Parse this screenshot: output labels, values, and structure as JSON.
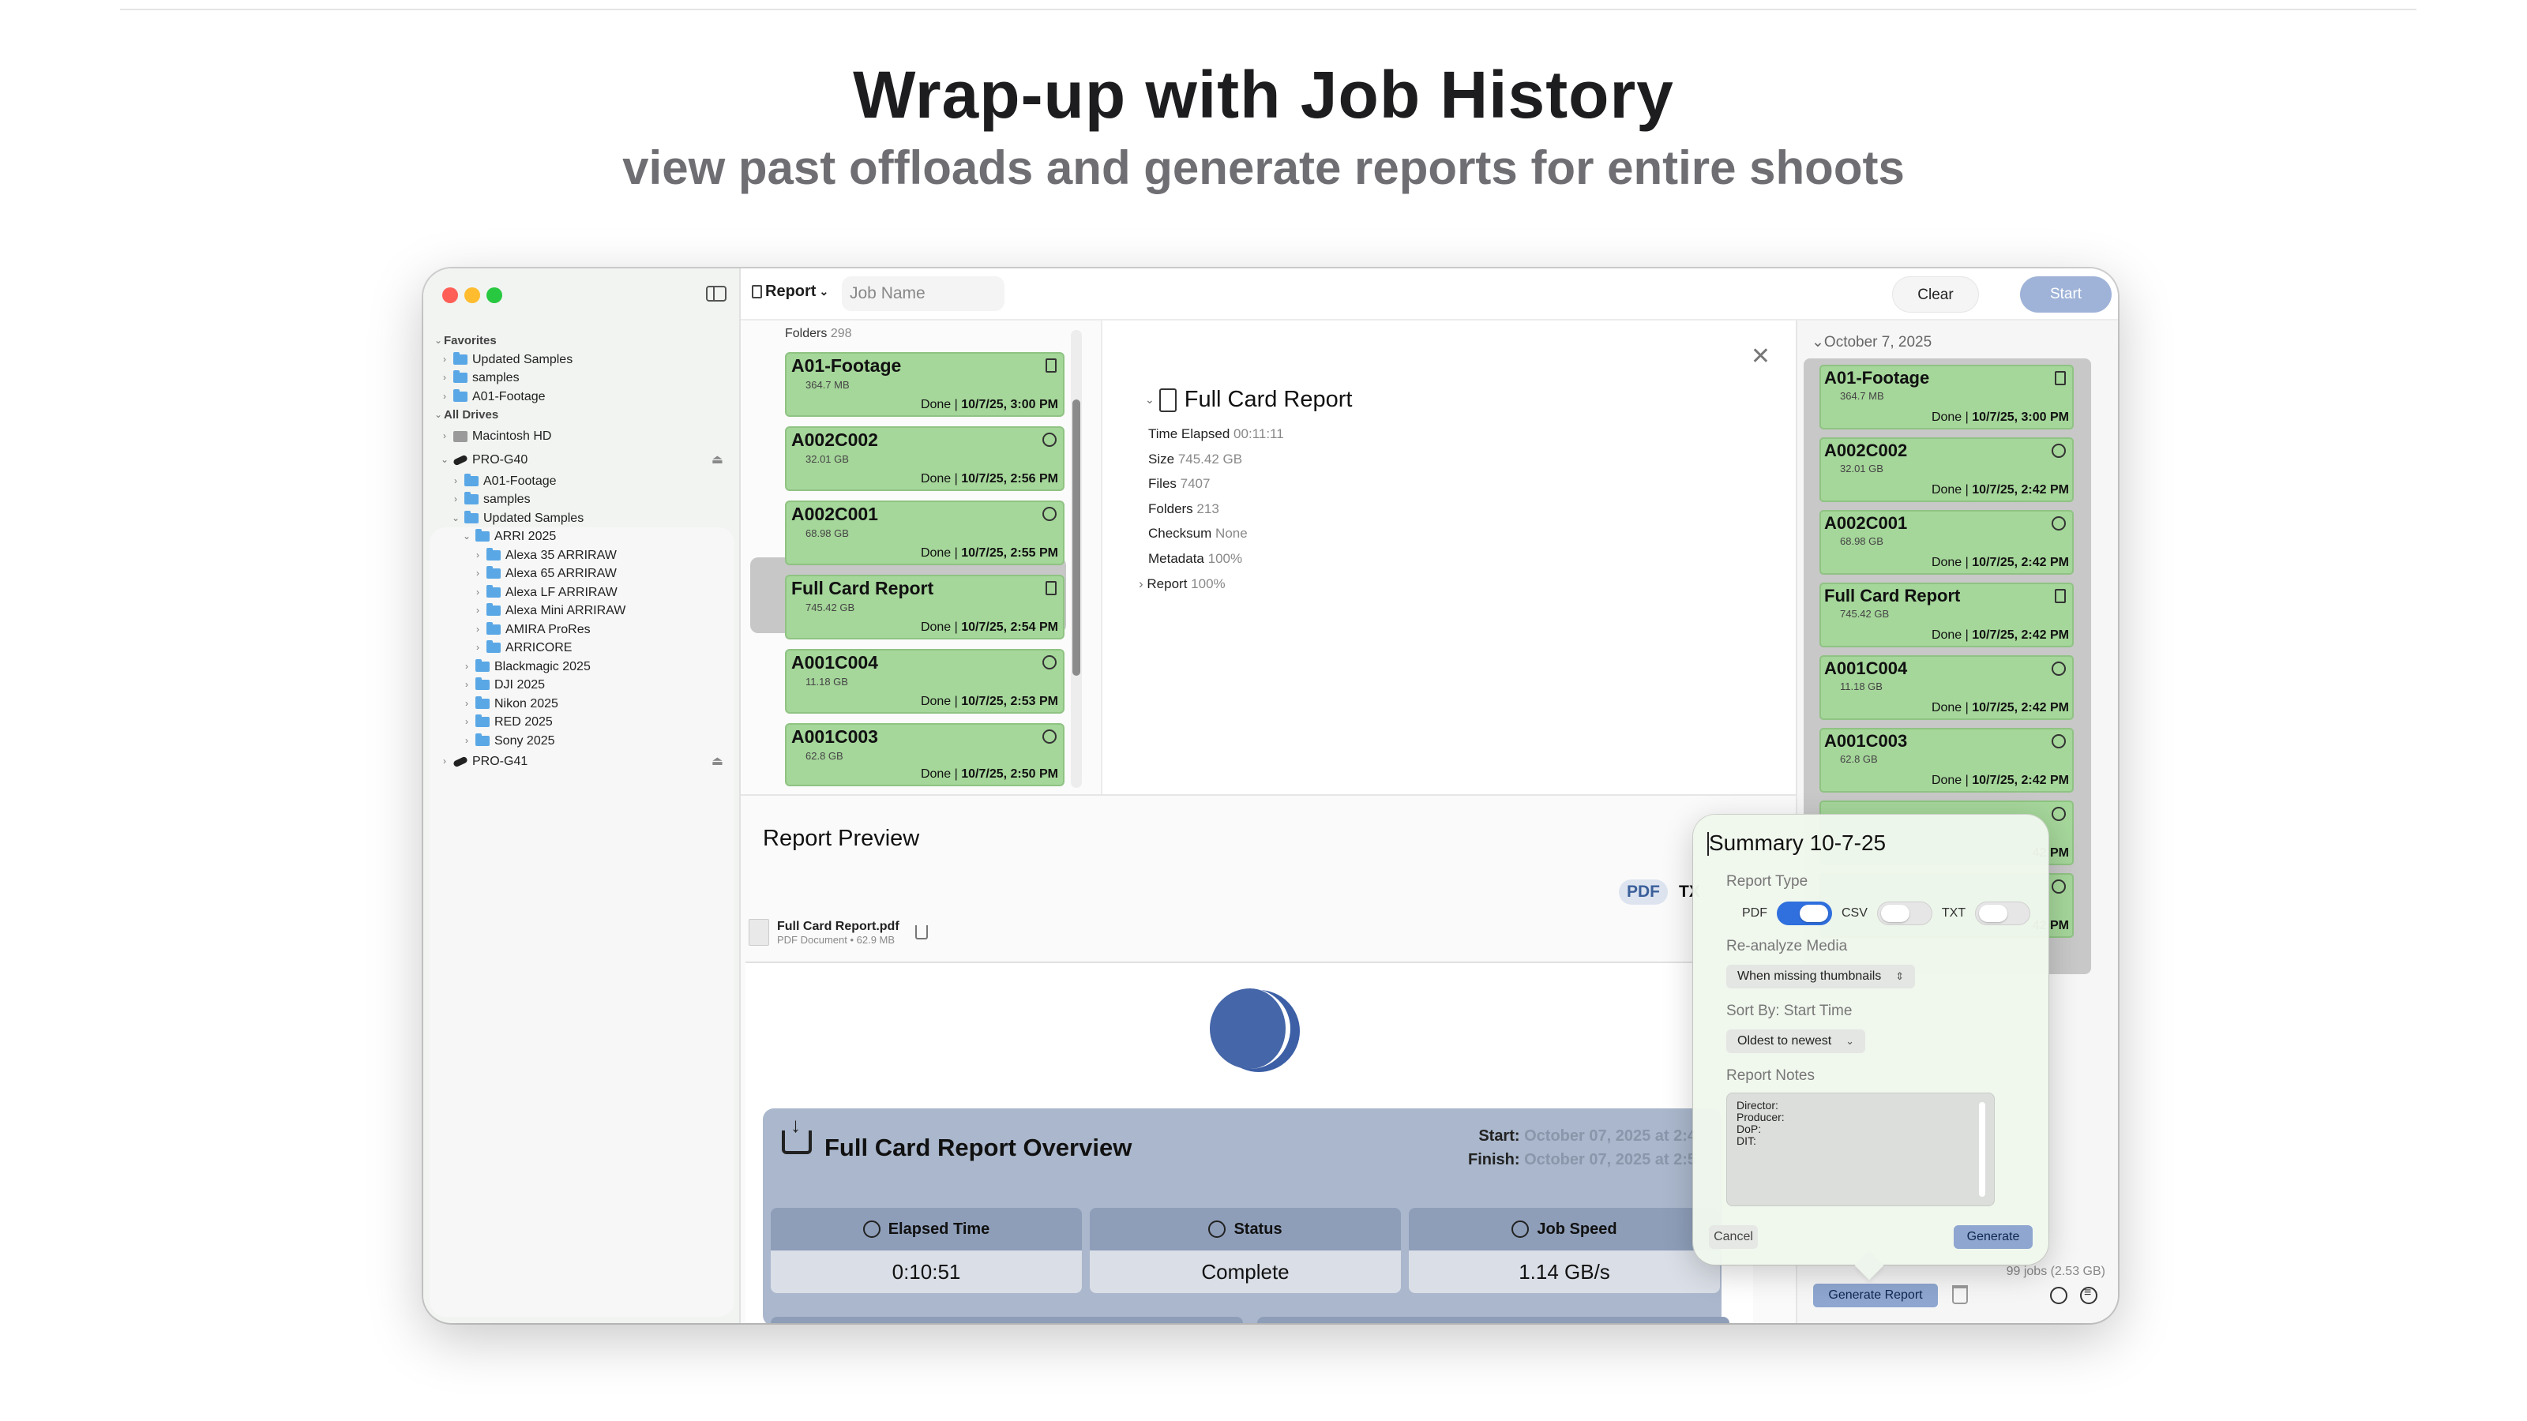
{
  "hero": {
    "title": "Wrap-up with Job History",
    "subtitle": "view past offloads and generate reports for entire shoots"
  },
  "toolbar": {
    "report_menu": "Report",
    "job_name_placeholder": "Job Name",
    "clear_label": "Clear",
    "start_label": "Start"
  },
  "sidebar": {
    "favorites_header": "Favorites",
    "favorites": [
      "Updated Samples",
      "samples",
      "A01-Footage"
    ],
    "all_drives_header": "All Drives",
    "drives": {
      "macintosh": "Macintosh HD",
      "pro_g40": "PRO-G40",
      "pro_g40_children": [
        "A01-Footage",
        "samples",
        "Updated Samples"
      ],
      "arri": "ARRI 2025",
      "arri_children": [
        "Alexa 35 ARRIRAW",
        "Alexa 65 ARRIRAW",
        "Alexa LF ARRIRAW",
        "Alexa Mini ARRIRAW",
        "AMIRA ProRes",
        "ARRICORE"
      ],
      "brands": [
        "Blackmagic 2025",
        "DJI 2025",
        "Nikon 2025",
        "RED 2025",
        "Sony 2025"
      ],
      "pro_g41": "PRO-G41"
    }
  },
  "jobs": {
    "folders_label": "Folders",
    "folders_count": "298",
    "items": [
      {
        "name": "A01-Footage",
        "size": "364.7 MB",
        "status": "Done",
        "time": "10/7/25, 3:00 PM",
        "icon": "document-icon"
      },
      {
        "name": "A002C002",
        "size": "32.01 GB",
        "status": "Done",
        "time": "10/7/25, 2:56 PM",
        "icon": "ring-icon"
      },
      {
        "name": "A002C001",
        "size": "68.98 GB",
        "status": "Done",
        "time": "10/7/25, 2:55 PM",
        "icon": "ring-icon"
      },
      {
        "name": "Full Card Report",
        "size": "745.42 GB",
        "status": "Done",
        "time": "10/7/25, 2:54 PM",
        "icon": "document-icon"
      },
      {
        "name": "A001C004",
        "size": "11.18 GB",
        "status": "Done",
        "time": "10/7/25, 2:53 PM",
        "icon": "ring-icon"
      },
      {
        "name": "A001C003",
        "size": "62.8 GB",
        "status": "Done",
        "time": "10/7/25, 2:50 PM",
        "icon": "ring-icon"
      }
    ]
  },
  "detail": {
    "title": "Full Card Report",
    "rows": [
      {
        "label": "Time Elapsed",
        "value": "00:11:11"
      },
      {
        "label": "Size",
        "value": "745.42 GB"
      },
      {
        "label": "Files",
        "value": "7407"
      },
      {
        "label": "Folders",
        "value": "213"
      },
      {
        "label": "Checksum",
        "value": "None"
      },
      {
        "label": "Metadata",
        "value": "100%"
      },
      {
        "label": "Report",
        "value": "100%"
      }
    ]
  },
  "preview": {
    "title": "Report Preview",
    "format_pdf": "PDF",
    "format_txt": "TX",
    "file_name": "Full Card Report.pdf",
    "file_meta": "PDF Document • 62.9 MB",
    "overview_title": "Full Card Report Overview",
    "start_label": "Start:",
    "start_value": "October 07, 2025 at 2:4",
    "finish_label": "Finish:",
    "finish_value": "October 07, 2025 at 2:5",
    "stats": [
      {
        "label": "Elapsed Time",
        "value": "0:10:51",
        "icon": "stopwatch-icon"
      },
      {
        "label": "Status",
        "value": "Complete",
        "icon": "checkmark-circle-icon"
      },
      {
        "label": "Job Speed",
        "value": "1.14 GB/s",
        "icon": "speedometer-icon"
      }
    ]
  },
  "history": {
    "date_header": "October 7, 2025",
    "items": [
      {
        "name": "A01-Footage",
        "size": "364.7 MB",
        "status": "Done",
        "time": "10/7/25, 3:00 PM",
        "icon": "document-icon"
      },
      {
        "name": "A002C002",
        "size": "32.01 GB",
        "status": "Done",
        "time": "10/7/25, 2:42 PM",
        "icon": "ring-icon"
      },
      {
        "name": "A002C001",
        "size": "68.98 GB",
        "status": "Done",
        "time": "10/7/25, 2:42 PM",
        "icon": "ring-icon"
      },
      {
        "name": "Full Card Report",
        "size": "745.42 GB",
        "status": "Done",
        "time": "10/7/25, 2:42 PM",
        "icon": "document-icon"
      },
      {
        "name": "A001C004",
        "size": "11.18 GB",
        "status": "Done",
        "time": "10/7/25, 2:42 PM",
        "icon": "ring-icon"
      },
      {
        "name": "A001C003",
        "size": "62.8 GB",
        "status": "Done",
        "time": "10/7/25, 2:42 PM",
        "icon": "ring-icon"
      }
    ],
    "partial_times": [
      "42 PM",
      "42 PM"
    ],
    "jobs_count": "99 jobs (2.53 GB)",
    "generate_report_label": "Generate Report"
  },
  "popover": {
    "summary_title": "Summary 10-7-25",
    "report_type_label": "Report Type",
    "pdf_label": "PDF",
    "pdf_on": true,
    "csv_label": "CSV",
    "csv_on": false,
    "txt_label": "TXT",
    "txt_on": false,
    "reanalyze_label": "Re-analyze Media",
    "reanalyze_value": "When missing thumbnails",
    "sort_label": "Sort By: Start Time",
    "sort_value": "Oldest to newest",
    "notes_label": "Report Notes",
    "notes_value": "Director:\nProducer:\nDoP:\nDIT:",
    "cancel_label": "Cancel",
    "generate_label": "Generate"
  },
  "colors": {
    "job_done_green": "#a5d69a",
    "accent_blue": "#8ea6d0",
    "toggle_on": "#2f6fde",
    "overview_card": "#aab7cc"
  }
}
